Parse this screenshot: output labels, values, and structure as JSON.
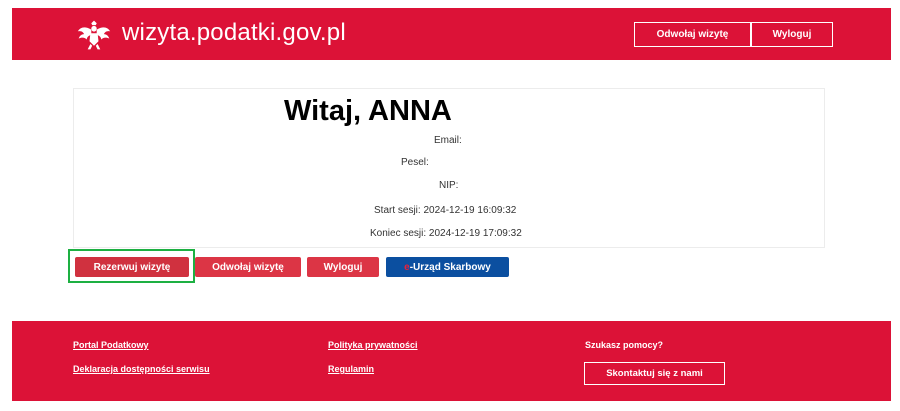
{
  "header": {
    "site_title": "wizyta.podatki.gov.pl",
    "cancel_visit_label": "Odwołaj wizytę",
    "logout_label": "Wyloguj"
  },
  "card": {
    "greeting": "Witaj, ANNA",
    "email_label": "Email:",
    "pesel_label": "Pesel:",
    "nip_label": "NIP:",
    "session_start": "Start sesji: 2024-12-19 16:09:32",
    "session_end": "Koniec sesji: 2024-12-19 17:09:32"
  },
  "actions": {
    "reserve_label": "Rezerwuj wizytę",
    "cancel_label": "Odwołaj wizytę",
    "logout_label": "Wyloguj",
    "office_prefix": "e",
    "office_label": "-Urząd Skarbowy"
  },
  "footer": {
    "links": [
      "Portal Podatkowy",
      "Deklaracja dostępności serwisu",
      "Polityka prywatności",
      "Regulamin"
    ],
    "help_title": "Szukasz pomocy?",
    "contact_label": "Skontaktuj się z nami"
  },
  "colors": {
    "brand_red": "#dc1237",
    "button_red": "#dc3545",
    "office_blue": "#0b4fa0",
    "highlight_green": "#1db042"
  },
  "icons": {
    "logo": "polish-eagle-icon"
  }
}
